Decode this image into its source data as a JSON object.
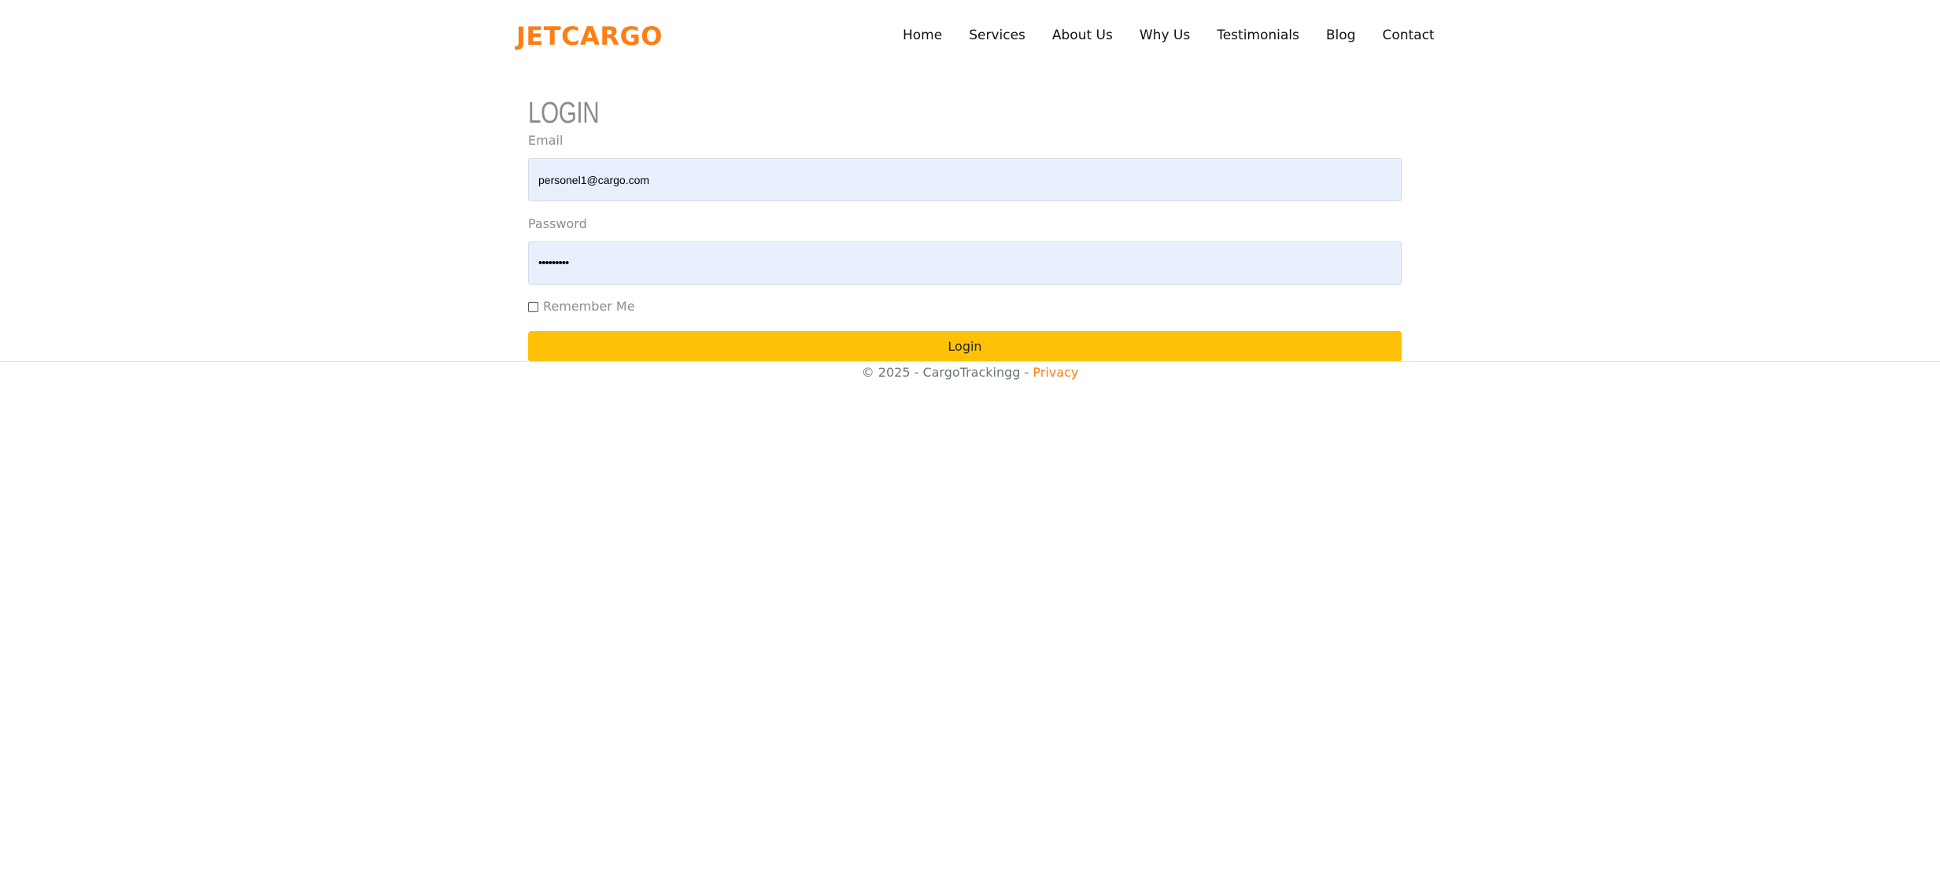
{
  "brand": {
    "name": "JETCARGO",
    "color": "#fd7e14"
  },
  "nav": {
    "items": [
      {
        "label": "Home"
      },
      {
        "label": "Services"
      },
      {
        "label": "About Us"
      },
      {
        "label": "Why Us"
      },
      {
        "label": "Testimonials"
      },
      {
        "label": "Blog"
      },
      {
        "label": "Contact"
      }
    ]
  },
  "login": {
    "title": "LOGIN",
    "email_label": "Email",
    "email_value": "personel1@cargo.com",
    "password_label": "Password",
    "password_value": "•••••••••",
    "remember_label": "Remember Me",
    "remember_checked": false,
    "submit_label": "Login",
    "button_color": "#ffc107",
    "input_bg": "#e8f0fe"
  },
  "footer": {
    "copyright": "© 2025 - CargoTrackingg - ",
    "privacy_label": "Privacy"
  }
}
